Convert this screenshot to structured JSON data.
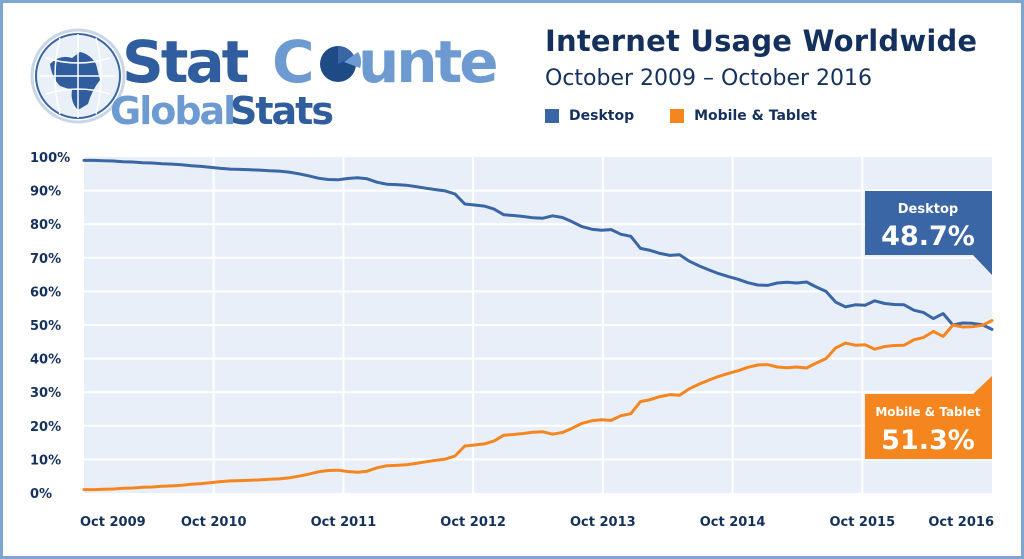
{
  "header": {
    "logo_line1_a": "Stat",
    "logo_line1_b": "C",
    "logo_line1_c": "unter",
    "logo_line2_a": "Global",
    "logo_line2_b": "Stats",
    "logo_icon": "globe-icon",
    "title": "Internet Usage Worldwide",
    "subtitle": "October 2009 – October 2016"
  },
  "colors": {
    "desktop": "#3a66a5",
    "mobile": "#f5861f",
    "plot_bg": "#e9eff8",
    "grid": "#ffffff",
    "text": "#14305c",
    "frame": "#7ea6d3"
  },
  "chart_data": {
    "type": "line",
    "title": "Internet Usage Worldwide",
    "subtitle": "October 2009 – October 2016",
    "xlabel": "",
    "ylabel": "",
    "ylim": [
      0,
      100
    ],
    "y_ticks": [
      "0%",
      "10%",
      "20%",
      "30%",
      "40%",
      "50%",
      "60%",
      "70%",
      "80%",
      "90%",
      "100%"
    ],
    "x_ticks": [
      "Oct 2009",
      "Oct 2010",
      "Oct 2011",
      "Oct 2012",
      "Oct 2013",
      "Oct 2014",
      "Oct 2015",
      "Oct 2016"
    ],
    "x_start": "Oct 2009",
    "x_end": "Oct 2016",
    "x_unit": "month",
    "grid": true,
    "legend_position": "top",
    "series": [
      {
        "name": "Desktop",
        "color": "#3a66a5",
        "final_label": "48.7%",
        "values": [
          99.0,
          99.0,
          98.9,
          98.8,
          98.6,
          98.5,
          98.3,
          98.2,
          98.0,
          97.9,
          97.7,
          97.4,
          97.2,
          96.9,
          96.6,
          96.4,
          96.3,
          96.2,
          96.1,
          95.9,
          95.8,
          95.5,
          95.0,
          94.4,
          93.7,
          93.3,
          93.2,
          93.6,
          93.8,
          93.5,
          92.5,
          91.9,
          91.8,
          91.6,
          91.2,
          90.7,
          90.3,
          89.9,
          89.0,
          86.0,
          85.7,
          85.4,
          84.5,
          82.8,
          82.6,
          82.3,
          81.9,
          81.8,
          82.5,
          82.0,
          80.7,
          79.3,
          78.5,
          78.2,
          78.4,
          77.0,
          76.4,
          72.8,
          72.2,
          71.3,
          70.7,
          70.9,
          69.0,
          67.6,
          66.4,
          65.3,
          64.4,
          63.6,
          62.6,
          61.9,
          61.8,
          62.5,
          62.7,
          62.5,
          62.8,
          61.3,
          60.0,
          56.8,
          55.4,
          56.0,
          55.9,
          57.2,
          56.4,
          56.1,
          56.0,
          54.4,
          53.7,
          51.9,
          53.4,
          50.0,
          50.6,
          50.5,
          50.1,
          48.7
        ]
      },
      {
        "name": "Mobile & Tablet",
        "color": "#f5861f",
        "final_label": "51.3%",
        "values": [
          1.0,
          1.0,
          1.1,
          1.2,
          1.4,
          1.5,
          1.7,
          1.8,
          2.0,
          2.1,
          2.3,
          2.6,
          2.8,
          3.1,
          3.4,
          3.6,
          3.7,
          3.8,
          3.9,
          4.1,
          4.2,
          4.5,
          5.0,
          5.6,
          6.3,
          6.7,
          6.8,
          6.4,
          6.2,
          6.5,
          7.5,
          8.1,
          8.2,
          8.4,
          8.8,
          9.3,
          9.7,
          10.1,
          11.0,
          14.0,
          14.3,
          14.6,
          15.5,
          17.2,
          17.4,
          17.7,
          18.1,
          18.2,
          17.5,
          18.0,
          19.3,
          20.7,
          21.5,
          21.8,
          21.6,
          23.0,
          23.6,
          27.2,
          27.8,
          28.7,
          29.3,
          29.1,
          31.0,
          32.4,
          33.6,
          34.7,
          35.6,
          36.4,
          37.4,
          38.1,
          38.2,
          37.5,
          37.3,
          37.5,
          37.2,
          38.7,
          40.0,
          43.2,
          44.6,
          44.0,
          44.1,
          42.8,
          43.6,
          43.9,
          44.0,
          45.6,
          46.3,
          48.1,
          46.6,
          50.0,
          49.4,
          49.5,
          49.9,
          51.3
        ]
      }
    ],
    "callouts": [
      {
        "series": "Desktop",
        "label": "Desktop",
        "value": "48.7%"
      },
      {
        "series": "Mobile & Tablet",
        "label": "Mobile & Tablet",
        "value": "51.3%"
      }
    ]
  },
  "legend": [
    {
      "label": "Desktop",
      "color": "#3a66a5"
    },
    {
      "label": "Mobile & Tablet",
      "color": "#f5861f"
    }
  ]
}
